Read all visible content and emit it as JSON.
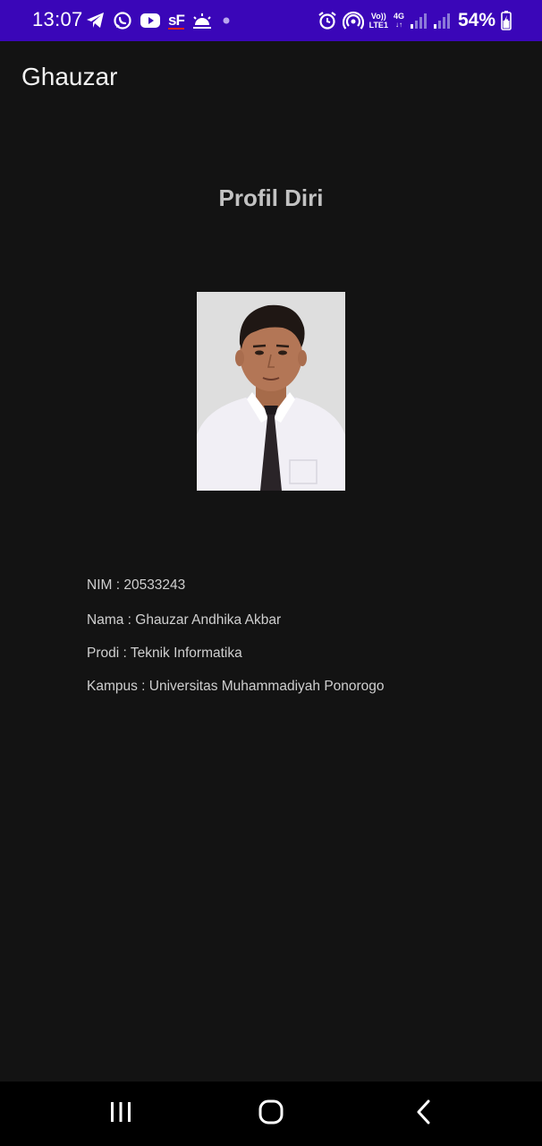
{
  "status_bar": {
    "time": "13:07",
    "left_icons": [
      "telegram-icon",
      "whatsapp-icon",
      "youtube-icon",
      "sf-app-icon",
      "weather-icon",
      "notification-dot-icon"
    ],
    "sf_label": "sF",
    "right_icons": [
      "alarm-icon",
      "hotspot-icon",
      "volte-icon",
      "4g-icon",
      "signal-icon",
      "signal-icon",
      "battery-icon"
    ],
    "volte_line1": "Vo))",
    "volte_line2": "LTE1",
    "network_type": "4G",
    "battery_percent": "54%"
  },
  "app_bar": {
    "title": "Ghauzar"
  },
  "profile": {
    "heading": "Profil Diri",
    "photo_icon": "profile-photo",
    "nim": "NIM : 20533243",
    "nama": "Nama : Ghauzar Andhika Akbar",
    "prodi": "Prodi : Teknik Informatika",
    "kampus": "Kampus : Universitas Muhammadiyah Ponorogo"
  },
  "nav_bar": {
    "buttons": [
      "recent-apps-icon",
      "home-icon",
      "back-icon"
    ]
  },
  "colors": {
    "status_bar_bg": "#3a06b8",
    "background": "#131313",
    "heading_text": "#c2c2c2",
    "body_text": "#cfcfcf",
    "nav_bar_bg": "#000000"
  }
}
